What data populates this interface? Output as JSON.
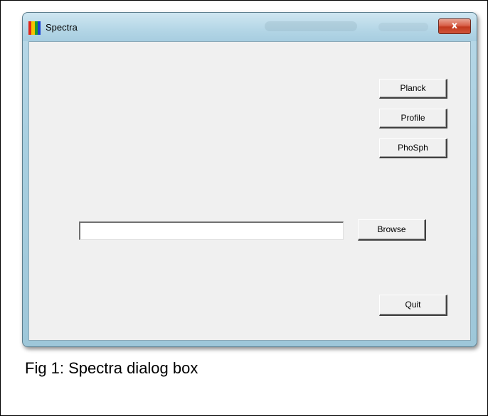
{
  "window": {
    "title": "Spectra",
    "close_label": "x",
    "icon_colors": [
      "#e0261a",
      "#f5c400",
      "#1f9d2a",
      "#1a3fd6"
    ]
  },
  "buttons": {
    "planck": "Planck",
    "profile": "Profile",
    "phosph": "PhoSph",
    "browse": "Browse",
    "quit": "Quit"
  },
  "file_input": {
    "value": "",
    "placeholder": ""
  },
  "caption": "Fig 1: Spectra dialog box"
}
